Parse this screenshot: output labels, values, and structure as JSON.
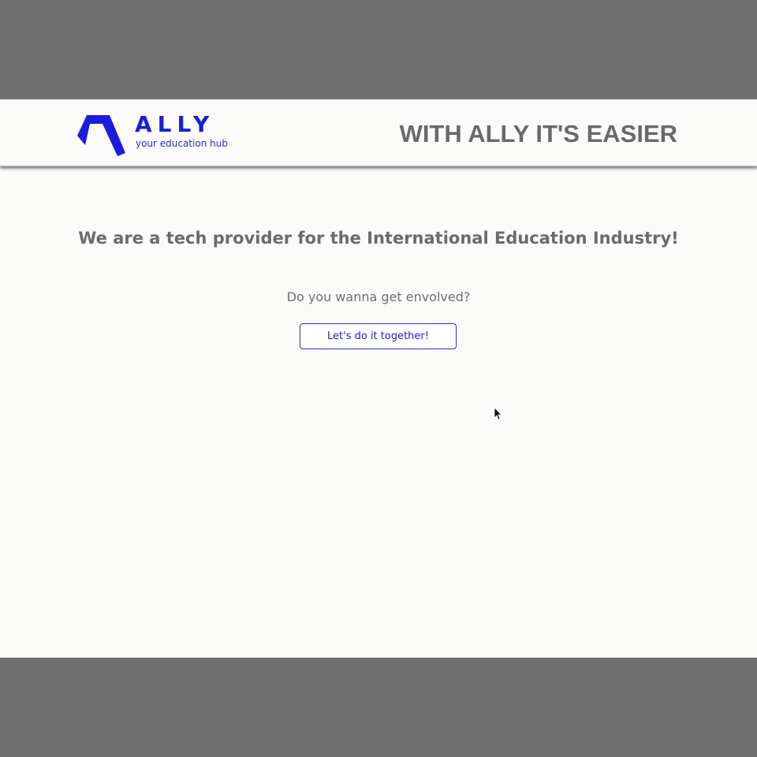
{
  "header": {
    "logo": {
      "name": "ALLY",
      "tagline": "your education hub"
    },
    "slogan": "WITH ALLY IT'S EASIER"
  },
  "main": {
    "headline": "We are a tech provider for the International Education Industry!",
    "question": "Do you wanna get envolved?",
    "cta_label": "Let's do it together!"
  },
  "colors": {
    "brand": "#1c1ce0",
    "text_gray": "#6b6b6b",
    "page_background": "#fbfbfa",
    "outer_background": "#6f6f6f"
  },
  "icons": {
    "logo_mark": "ally-logo-mark",
    "pointer": "mouse-cursor-icon"
  }
}
